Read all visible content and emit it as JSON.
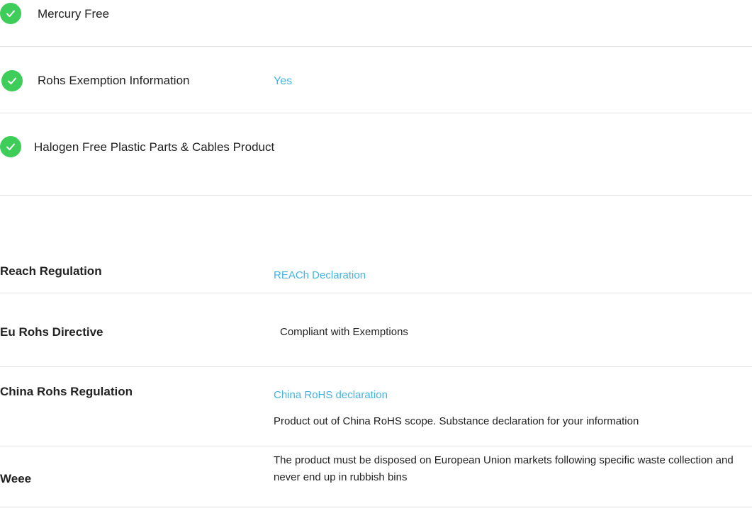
{
  "environmental_checks": [
    {
      "label": "Mercury Free",
      "value": ""
    },
    {
      "label": "Rohs Exemption Information",
      "value": "Yes"
    },
    {
      "label": "Halogen Free Plastic Parts & Cables Product",
      "value": ""
    }
  ],
  "regulations": [
    {
      "label": "Reach Regulation",
      "link": "REACh Declaration",
      "text": ""
    },
    {
      "label": "Eu Rohs Directive",
      "link": "",
      "text": "Compliant with Exemptions"
    },
    {
      "label": "China Rohs Regulation",
      "link": "China RoHS declaration",
      "text": "Product out of China RoHS scope. Substance declaration for your information"
    },
    {
      "label": "Weee",
      "link": "",
      "text": "The product must be disposed on European Union markets following specific waste collection and never end up in rubbish bins"
    }
  ],
  "colors": {
    "check_icon": "#3dcd58",
    "link": "#42b4e6",
    "divider": "#e3e3e3",
    "text": "#222222"
  },
  "icons": {
    "check": "check-circle-icon"
  }
}
